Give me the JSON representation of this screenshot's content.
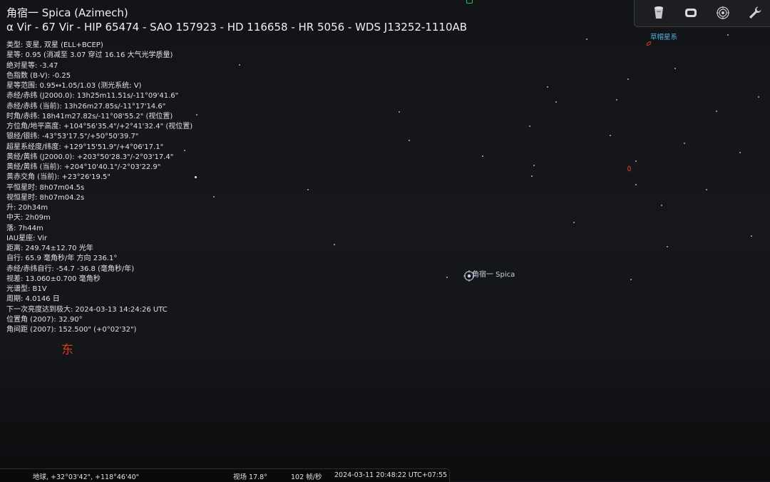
{
  "object": {
    "title": "角宿一 Spica (Azimech)",
    "designations": "α Vir - 67 Vir - HIP 65474 - SAO 157923 - HD 116658 - HR 5056 - WDS J13252-1110AB",
    "info_lines": [
      "类型: 变星, 双星 (ELL+BCEP)",
      "星等: 0.95 (消减至 3.07 穿过 16.16 大气光学质量)",
      "绝对星等: -3.47",
      "色指数 (B-V): -0.25",
      "星等范围: 0.95↔1.05/1.03 (测光系统: V)",
      "赤经/赤纬 (J2000.0): 13h25m11.51s/-11°09'41.6\"",
      "赤经/赤纬 (当前): 13h26m27.85s/-11°17'14.6\"",
      "时角/赤纬: 18h41m27.82s/-11°08'55.2\" (视位置)",
      "方位角/地平高度: +104°56'35.4\"/+2°41'32.4\" (视位置)",
      "银经/银纬: -43°53'17.5\"/+50°50'39.7\"",
      "超星系经度/纬度: +129°15'51.9\"/+4°06'17.1\"",
      "黄经/黄纬 (J2000.0): +203°50'28.3\"/-2°03'17.4\"",
      "黄经/黄纬 (当前): +204°10'40.1\"/-2°03'22.9\"",
      "黄赤交角 (当前): +23°26'19.5\"",
      "平恒星时: 8h07m04.5s",
      "视恒星时: 8h07m04.2s",
      "升: 20h34m",
      "中天: 2h09m",
      "落: 7h44m",
      "IAU星座: Vir",
      "距离: 249.74±12.70 光年",
      "自行: 65.9 毫角秒/年 方向 236.1°",
      "赤经/赤纬自行: -54.7 -36.8 (毫角秒/年)",
      "视差: 13.060±0.700 毫角秒",
      "光谱型: B1V",
      "周期: 4.0146 日",
      "下一次亮度达到极大: 2024-03-13 14:24:26 UTC",
      "位置角 (2007): 32.90°",
      "角间距 (2007): 152.500\" (+0°02'32\")"
    ]
  },
  "sky": {
    "target_label": "角宿一 Spica",
    "galaxy_label": "草帽星系",
    "cardinal_east": "东"
  },
  "toolbar": {
    "buttons": [
      {
        "name": "telescope-control-button",
        "icon": "telescope-icon"
      },
      {
        "name": "ocular-view-button",
        "icon": "ocular-icon"
      },
      {
        "name": "satellites-button",
        "icon": "satellite-icon"
      },
      {
        "name": "configuration-button",
        "icon": "wrench-icon"
      }
    ]
  },
  "status_bar": {
    "location": "地球, +32°03'42\", +118°46'40\"",
    "fov": "视场 17.8°",
    "fps": "102 帧/秒",
    "datetime": "2024-03-11 20:48:22 UTC+07:55"
  },
  "colors": {
    "cardinal": "#d93a1e",
    "galaxy_label": "#4fb0d8",
    "galaxy_marker": "#d0402a"
  }
}
